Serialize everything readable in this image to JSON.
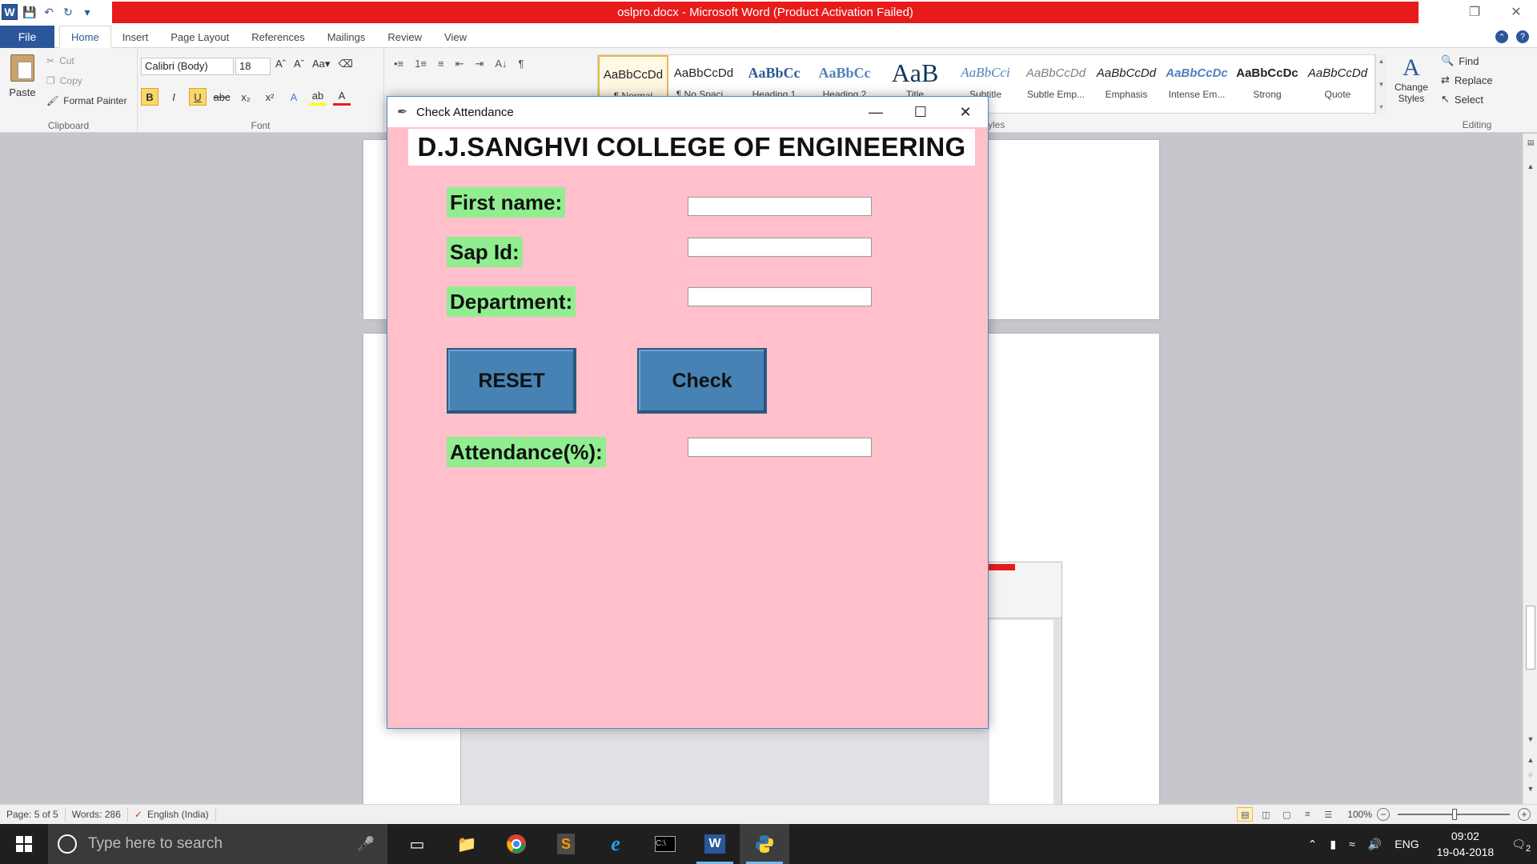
{
  "word": {
    "window_title": "oslpro.docx - Microsoft Word (Product Activation Failed)",
    "tabs": [
      "File",
      "Home",
      "Insert",
      "Page Layout",
      "References",
      "Mailings",
      "Review",
      "View"
    ],
    "active_tab": "Home",
    "clipboard": {
      "paste": "Paste",
      "cut": "Cut",
      "copy": "Copy",
      "format_painter": "Format Painter",
      "group_label": "Clipboard"
    },
    "font": {
      "family": "Calibri (Body)",
      "size": "18",
      "group_label": "Font"
    },
    "styles": {
      "items": [
        {
          "sample": "AaBbCcDd",
          "name": "¶ Normal"
        },
        {
          "sample": "AaBbCcDd",
          "name": "¶ No Spaci..."
        },
        {
          "sample": "AaBbCc",
          "name": "Heading 1"
        },
        {
          "sample": "AaBbCc",
          "name": "Heading 2"
        },
        {
          "sample": "AaB",
          "name": "Title"
        },
        {
          "sample": "AaBbCci",
          "name": "Subtitle"
        },
        {
          "sample": "AaBbCcDd",
          "name": "Subtle Emp..."
        },
        {
          "sample": "AaBbCcDd",
          "name": "Emphasis"
        },
        {
          "sample": "AaBbCcDc",
          "name": "Intense Em..."
        },
        {
          "sample": "AaBbCcDc",
          "name": "Strong"
        },
        {
          "sample": "AaBbCcDd",
          "name": "Quote"
        }
      ],
      "group_label": "Styles",
      "change_styles": "Change Styles"
    },
    "editing": {
      "find": "Find",
      "replace": "Replace",
      "select": "Select",
      "group_label": "Editing"
    },
    "status": {
      "page": "Page: 5 of 5",
      "words": "Words: 286",
      "language": "English (India)",
      "zoom": "100%"
    }
  },
  "dialog": {
    "title": "Check Attendance",
    "college": "D.J.SANGHVI COLLEGE OF ENGINEERING",
    "first_name_label": "First name:",
    "sap_id_label": "Sap Id:",
    "department_label": "Department:",
    "attendance_label": "Attendance(%):",
    "first_name_value": "",
    "sap_id_value": "",
    "department_value": "",
    "attendance_value": "",
    "reset_button": "RESET",
    "check_button": "Check",
    "colors": {
      "background": "#ffc0cb",
      "label_bg": "#90ee90",
      "button_bg": "#4682b4"
    }
  },
  "taskbar": {
    "search_placeholder": "Type here to search",
    "language": "ENG",
    "time": "09:02",
    "date": "19-04-2018",
    "notifications": "2"
  }
}
